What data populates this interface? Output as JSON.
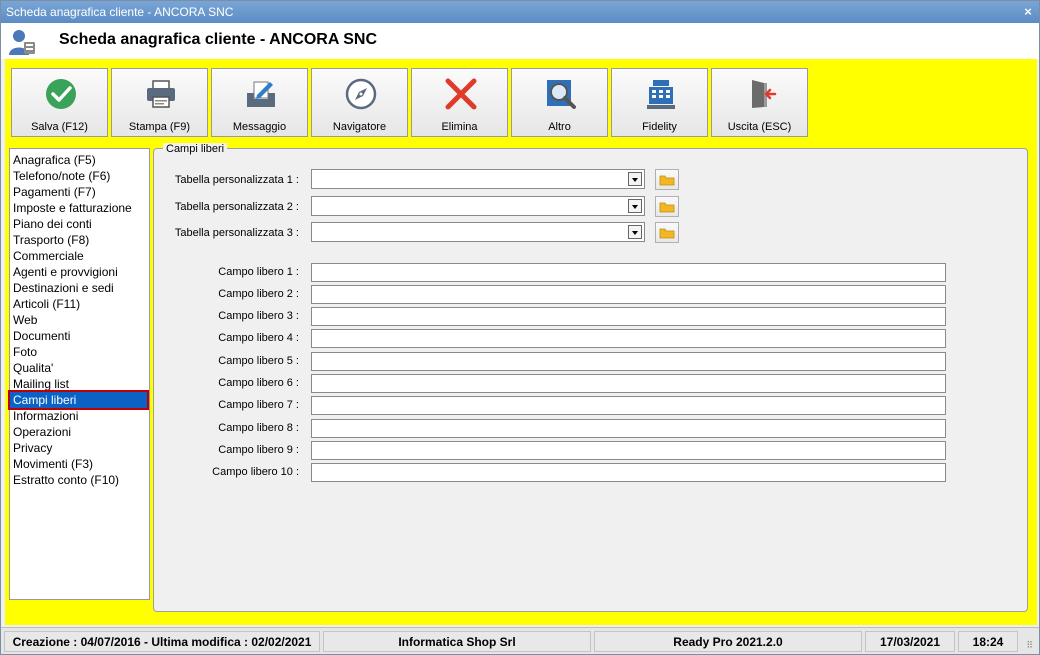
{
  "window": {
    "title": "Scheda anagrafica cliente - ANCORA SNC",
    "header_title": "Scheda anagrafica cliente - ANCORA SNC",
    "close_glyph": "×"
  },
  "toolbar": [
    {
      "label": "Salva (F12)",
      "icon": "check-icon"
    },
    {
      "label": "Stampa (F9)",
      "icon": "printer-icon"
    },
    {
      "label": "Messaggio",
      "icon": "message-icon"
    },
    {
      "label": "Navigatore",
      "icon": "compass-icon"
    },
    {
      "label": "Elimina",
      "icon": "delete-icon"
    },
    {
      "label": "Altro",
      "icon": "search-icon"
    },
    {
      "label": "Fidelity",
      "icon": "cash-register-icon"
    },
    {
      "label": "Uscita (ESC)",
      "icon": "exit-icon"
    }
  ],
  "nav": {
    "items": [
      "Anagrafica (F5)",
      "Telefono/note (F6)",
      "Pagamenti (F7)",
      "Imposte e fatturazione",
      "Piano dei conti",
      "Trasporto (F8)",
      "Commerciale",
      "Agenti e provvigioni",
      "Destinazioni e sedi",
      "Articoli (F11)",
      "Web",
      "Documenti",
      "Foto",
      "Qualita'",
      "Mailing list",
      "Campi liberi",
      "Informazioni",
      "Operazioni",
      "Privacy",
      "Movimenti (F3)",
      "Estratto conto (F10)"
    ],
    "selected": "Campi liberi"
  },
  "panel": {
    "legend": "Campi liberi",
    "tables": [
      {
        "label": "Tabella personalizzata 1 :",
        "value": ""
      },
      {
        "label": "Tabella personalizzata 2 :",
        "value": ""
      },
      {
        "label": "Tabella personalizzata 3 :",
        "value": ""
      }
    ],
    "fields": [
      {
        "label": "Campo libero 1 :",
        "value": ""
      },
      {
        "label": "Campo libero 2 :",
        "value": ""
      },
      {
        "label": "Campo libero 3 :",
        "value": ""
      },
      {
        "label": "Campo libero 4 :",
        "value": ""
      },
      {
        "label": "Campo libero 5 :",
        "value": ""
      },
      {
        "label": "Campo libero 6 :",
        "value": ""
      },
      {
        "label": "Campo libero 7 :",
        "value": ""
      },
      {
        "label": "Campo libero 8 :",
        "value": ""
      },
      {
        "label": "Campo libero 9 :",
        "value": ""
      },
      {
        "label": "Campo libero 10 :",
        "value": ""
      }
    ]
  },
  "status": {
    "dates": "Creazione : 04/07/2016 - Ultima modifica : 02/02/2021",
    "company": "Informatica Shop Srl",
    "product": "Ready Pro 2021.2.0",
    "date": "17/03/2021",
    "time": "18:24"
  },
  "colors": {
    "title_bar": "#5b8cc4",
    "work_area": "#ffff00",
    "selection": "#0a62c4",
    "highlight_border": "#c00000"
  }
}
